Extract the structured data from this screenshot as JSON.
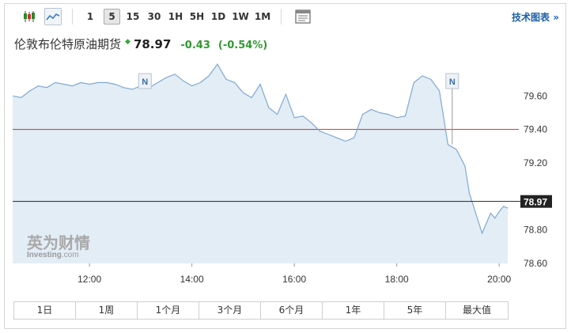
{
  "toolbar": {
    "chart_type_icons": [
      "candlestick-icon",
      "line-chart-icon"
    ],
    "timeframes": [
      "1",
      "5",
      "15",
      "30",
      "1H",
      "5H",
      "1D",
      "1W",
      "1M"
    ],
    "active_timeframe": "5",
    "layout_icon": "layout-icon",
    "tech_chart_label": "技术图表",
    "tech_chart_arrow": "»"
  },
  "instrument": {
    "name": "伦敦布伦特原油期货",
    "price": "78.97",
    "change": "-0.43",
    "change_pct": "(-0.54%)",
    "status_arrow": "◆"
  },
  "watermark": {
    "cn": "英为财情",
    "en_bold": "Investing",
    "en_suffix": ".com"
  },
  "news_marker_label": "N",
  "range_buttons": [
    "1日",
    "1周",
    "1个月",
    "3个月",
    "6个月",
    "1年",
    "5年",
    "最大值"
  ],
  "colors": {
    "line": "#7fa9d0",
    "fill": "#e3edf6",
    "ref_line": "#b23a3a",
    "current_line": "#222222",
    "up_green": "#2eaa3a"
  },
  "chart_data": {
    "type": "area",
    "x_tick_labels": [
      "12:00",
      "14:00",
      "16:00",
      "18:00",
      "20:00"
    ],
    "y_tick_labels": [
      "79.60",
      "79.40",
      "79.20",
      "78.80",
      "78.60"
    ],
    "ylim": [
      78.6,
      79.8
    ],
    "previous_close": 79.4,
    "current_value_label": "78.97",
    "current_value": 78.97,
    "series": [
      {
        "times": [
          "10:30",
          "10:40",
          "10:50",
          "11:00",
          "11:10",
          "11:20",
          "11:30",
          "11:40",
          "11:50",
          "12:00",
          "12:10",
          "12:20",
          "12:30",
          "12:40",
          "12:50",
          "13:00",
          "13:10",
          "13:20",
          "13:30",
          "13:40",
          "13:50",
          "14:00",
          "14:10",
          "14:20",
          "14:30",
          "14:40",
          "14:50",
          "15:00",
          "15:10",
          "15:20",
          "15:30",
          "15:40",
          "15:50",
          "16:00",
          "16:10",
          "16:20",
          "16:30",
          "16:40",
          "16:50",
          "17:00",
          "17:10",
          "17:20",
          "17:30",
          "17:40",
          "17:50",
          "18:00",
          "18:10",
          "18:20",
          "18:30",
          "18:40",
          "18:50",
          "19:00",
          "19:10",
          "19:20",
          "19:25",
          "19:30",
          "19:40",
          "19:50",
          "19:55",
          "20:00",
          "20:05",
          "20:10"
        ],
        "values": [
          79.6,
          79.59,
          79.63,
          79.66,
          79.65,
          79.68,
          79.67,
          79.66,
          79.68,
          79.67,
          79.68,
          79.68,
          79.67,
          79.65,
          79.64,
          79.66,
          79.65,
          79.68,
          79.71,
          79.73,
          79.69,
          79.66,
          79.68,
          79.72,
          79.79,
          79.7,
          79.68,
          79.62,
          79.59,
          79.67,
          79.53,
          79.49,
          79.61,
          79.47,
          79.48,
          79.44,
          79.39,
          79.37,
          79.35,
          79.33,
          79.35,
          79.49,
          79.52,
          79.5,
          79.49,
          79.47,
          79.48,
          79.68,
          79.72,
          79.7,
          79.63,
          79.31,
          79.28,
          79.18,
          79.02,
          78.94,
          78.78,
          78.9,
          78.87,
          78.91,
          78.94,
          78.93
        ]
      }
    ],
    "news_markers": [
      {
        "time": "13:05",
        "label": "N"
      },
      {
        "time": "19:05",
        "label": "N"
      }
    ]
  }
}
